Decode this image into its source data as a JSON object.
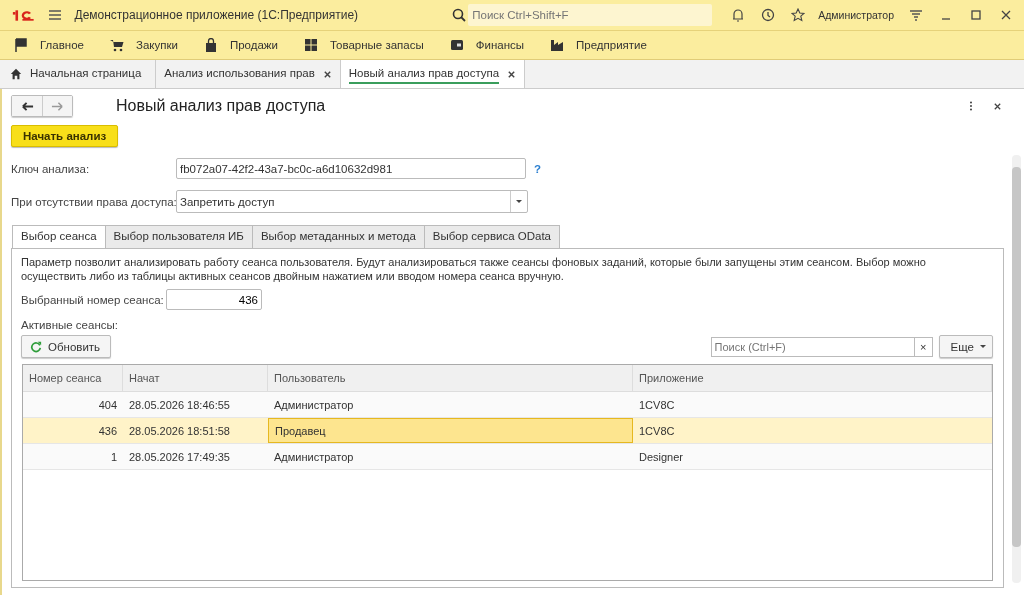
{
  "app": {
    "title": "Демонстрационное приложение  (1С:Предприятие)",
    "search_placeholder": "Поиск Ctrl+Shift+F",
    "user": "Администратор"
  },
  "sections": [
    {
      "label": "Главное",
      "kind": "flag"
    },
    {
      "label": "Закупки",
      "kind": "cart"
    },
    {
      "label": "Продажи",
      "kind": "bag"
    },
    {
      "label": "Товарные запасы",
      "kind": "grid"
    },
    {
      "label": "Финансы",
      "kind": "wallet"
    },
    {
      "label": "Предприятие",
      "kind": "factory"
    }
  ],
  "open_tabs": [
    {
      "label": "Начальная страница",
      "kind": "home",
      "selected": false
    },
    {
      "label": "Анализ использования прав",
      "kind": "closable",
      "selected": false
    },
    {
      "label": "Новый анализ прав доступа",
      "kind": "closable",
      "selected": true
    }
  ],
  "form": {
    "title": "Новый анализ прав доступа",
    "start_button": "Начать анализ",
    "key_label": "Ключ анализа:",
    "key_value": "fb072a07-42f2-43a7-bc0c-a6d10632d981",
    "help": "?",
    "access_label": "При отсутствии права доступа:",
    "access_value": "Запретить доступ",
    "tabs": [
      {
        "label": "Выбор сеанса",
        "selected": true
      },
      {
        "label": "Выбор пользователя ИБ",
        "selected": false
      },
      {
        "label": "Выбор метаданных и метода",
        "selected": false
      },
      {
        "label": "Выбор сервиса OData",
        "selected": false
      }
    ],
    "description": "Параметр позволит анализировать работу сеанса пользователя. Будут анализироваться также сеансы фоновых заданий, которые были запущены этим сеансом. Выбор можно осуществить либо из таблицы активных сеансов двойным нажатием или вводом номера сеанса вручную.",
    "session_label": "Выбранный номер сеанса:",
    "session_value": "436",
    "active_label": "Активные сеансы:",
    "refresh_button": "Обновить",
    "table_search_placeholder": "Поиск (Ctrl+F)",
    "clear": "×",
    "more_button": "Еще",
    "table": {
      "columns": [
        "Номер сеанса",
        "Начат",
        "Пользователь",
        "Приложение"
      ],
      "rows": [
        {
          "cells": [
            "404",
            "28.05.2026 18:46:55",
            "Администратор",
            "1CV8C"
          ],
          "selected": false
        },
        {
          "cells": [
            "436",
            "28.05.2026 18:51:58",
            "Продавец",
            "1CV8C"
          ],
          "selected": true
        },
        {
          "cells": [
            "1",
            "28.05.2026 17:49:35",
            "Администратор",
            "Designer"
          ],
          "selected": false
        }
      ]
    }
  }
}
